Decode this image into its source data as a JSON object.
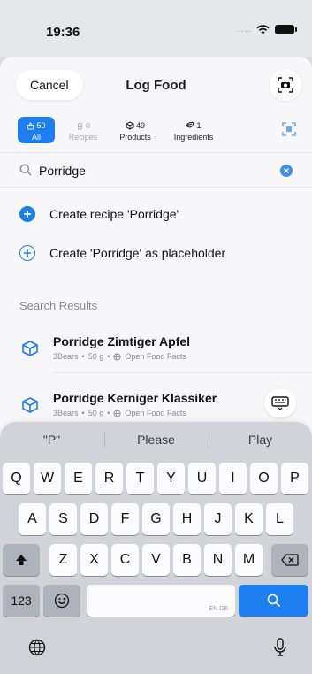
{
  "status_bar": {
    "time": "19:36",
    "signal_dots": "...."
  },
  "nav": {
    "cancel_label": "Cancel",
    "title": "Log Food",
    "scan_icon": "camera-scan-icon"
  },
  "filters": [
    {
      "name": "all",
      "count": "50",
      "label": "All",
      "icon": "basket-icon"
    },
    {
      "name": "recipes",
      "count": "0",
      "label": "Recipes",
      "icon": "chef-icon"
    },
    {
      "name": "products",
      "count": "49",
      "label": "Products",
      "icon": "package-icon"
    },
    {
      "name": "ingredients",
      "count": "1",
      "label": "Ingredients",
      "icon": "leaf-icon"
    }
  ],
  "search": {
    "value": "Porridge",
    "placeholder": "Search"
  },
  "actions": [
    {
      "label": "Create recipe 'Porridge'",
      "icon": "plus-circle-filled-icon"
    },
    {
      "label": "Create 'Porridge' as placeholder",
      "icon": "plus-circle-outline-icon"
    }
  ],
  "results_section": {
    "title": "Search Results"
  },
  "results": [
    {
      "title": "Porridge Zimtiger Apfel",
      "brand": "3Bears",
      "amount": "50 g",
      "source": "Open Food Facts"
    },
    {
      "title": "Porridge Kerniger Klassiker",
      "brand": "3Bears",
      "amount": "50 g",
      "source": "Open Food Facts"
    }
  ],
  "keyboard": {
    "suggestions": [
      "\"P\"",
      "Please",
      "Play"
    ],
    "row1": [
      "Q",
      "W",
      "E",
      "R",
      "T",
      "Y",
      "U",
      "I",
      "O",
      "P"
    ],
    "row2": [
      "A",
      "S",
      "D",
      "F",
      "G",
      "H",
      "J",
      "K",
      "L"
    ],
    "row3": [
      "Z",
      "X",
      "C",
      "V",
      "B",
      "N",
      "M"
    ],
    "numbers_label": "123",
    "space_lang": "EN DE"
  },
  "colors": {
    "accent": "#1d7ef0",
    "sheet_bg": "#f7f7f9",
    "keyboard_bg": "#d1d3d9"
  }
}
